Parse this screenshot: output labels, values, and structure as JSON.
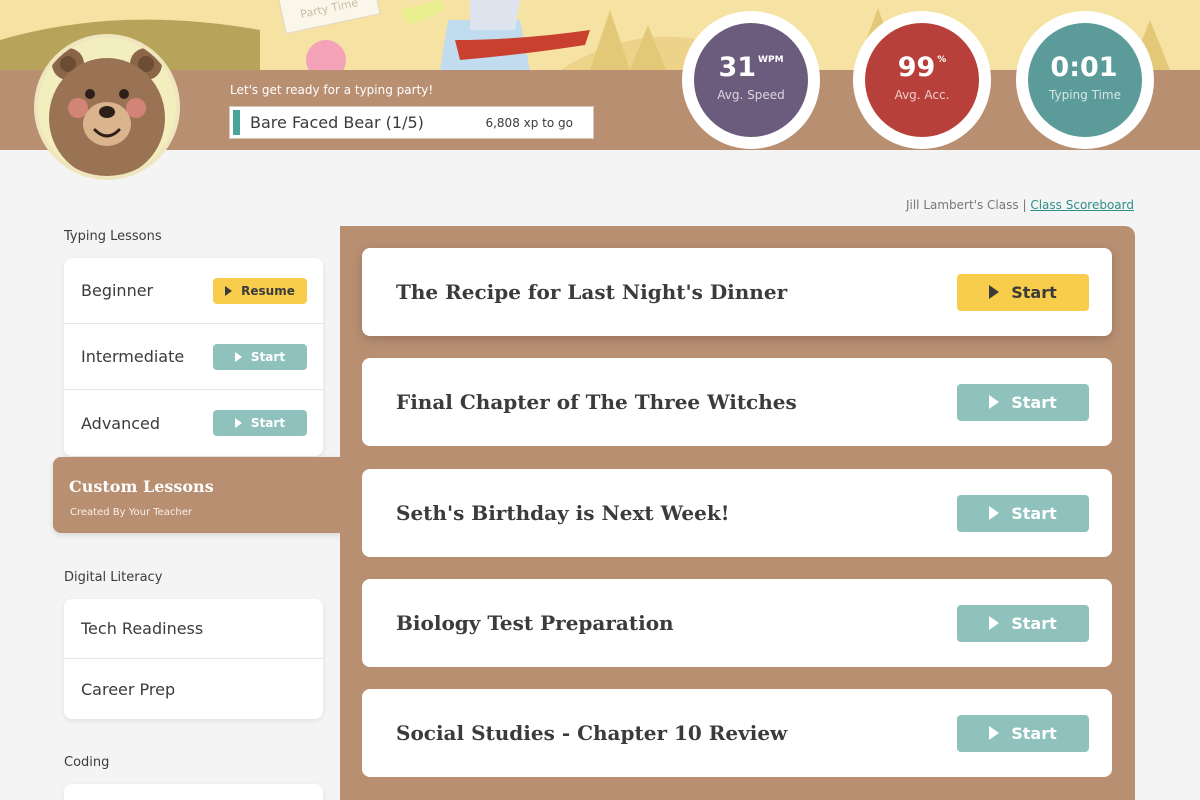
{
  "header": {
    "welcome": "Let's get ready for a typing party!",
    "level_name": "Bare Faced Bear (1/5)",
    "xp_to_go": "6,808 xp to go",
    "party_sign": "Party Time",
    "stats": [
      {
        "value": "31",
        "sup": "WPM",
        "label": "Avg. Speed",
        "color": "#6b5c7d"
      },
      {
        "value": "99",
        "sup": "%",
        "label": "Avg. Acc.",
        "color": "#b8403a"
      },
      {
        "value": "0:01",
        "sup": "",
        "label": "Typing Time",
        "color": "#5b9b9a"
      }
    ]
  },
  "class_line": {
    "class_name": "Jill Lambert's Class",
    "separator": "|",
    "scoreboard_link": "Class Scoreboard"
  },
  "sidebar": {
    "typing_lessons": {
      "heading": "Typing Lessons",
      "items": [
        {
          "label": "Beginner",
          "button": "Resume"
        },
        {
          "label": "Intermediate",
          "button": "Start"
        },
        {
          "label": "Advanced",
          "button": "Start"
        }
      ]
    },
    "custom_lessons": {
      "title": "Custom Lessons",
      "subtitle": "Created By Your Teacher"
    },
    "digital_literacy": {
      "heading": "Digital Literacy",
      "items": [
        {
          "label": "Tech Readiness"
        },
        {
          "label": "Career Prep"
        }
      ]
    },
    "coding": {
      "heading": "Coding"
    }
  },
  "lessons": [
    {
      "title": "The Recipe for Last Night's Dinner",
      "button": "Start"
    },
    {
      "title": "Final Chapter of The Three Witches",
      "button": "Start"
    },
    {
      "title": "Seth's Birthday is Next Week!",
      "button": "Start"
    },
    {
      "title": "Biology Test Preparation",
      "button": "Start"
    },
    {
      "title": "Social Studies - Chapter 10 Review",
      "button": "Start"
    }
  ],
  "colors": {
    "accent_yellow": "#f7cd4b",
    "accent_teal": "#90c2bd",
    "brown": "#b98f72"
  }
}
